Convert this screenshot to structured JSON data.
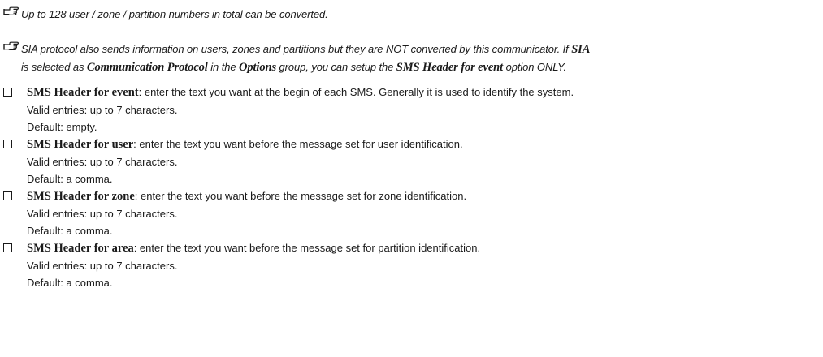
{
  "notes": [
    {
      "parts": [
        {
          "text": "Up to 128 user / zone / partition numbers in total can be converted.",
          "em": false
        }
      ]
    },
    {
      "line1": [
        {
          "text": "SIA protocol also sends information on users, zones and partitions but they are NOT converted by this communicator. If ",
          "em": false
        },
        {
          "text": "SIA",
          "em": true
        }
      ],
      "line2": [
        {
          "text": "is selected as ",
          "em": false
        },
        {
          "text": "Communication Protocol",
          "em": true
        },
        {
          "text": " in the ",
          "em": false
        },
        {
          "text": "Options",
          "em": true
        },
        {
          "text": " group, you can setup the ",
          "em": false
        },
        {
          "text": "SMS Header for event",
          "em": true
        },
        {
          "text": " option ONLY.",
          "em": false
        }
      ]
    }
  ],
  "items": [
    {
      "title": "SMS Header for event",
      "description": ": enter the text you want at the begin of each SMS. Generally it is used to identify the system.",
      "valid": "Valid entries: up to 7 characters.",
      "default": "Default: empty."
    },
    {
      "title": "SMS Header for user",
      "description": ": enter the text you want before the message set for user identification.",
      "valid": "Valid entries: up to 7 characters.",
      "default": "Default: a comma."
    },
    {
      "title": "SMS Header for zone",
      "description": ": enter the text you want before the message set for zone identification.",
      "valid": "Valid entries: up to 7 characters.",
      "default": "Default: a comma."
    },
    {
      "title": "SMS Header for area",
      "description": ": enter the text you want before the message set for partition identification.",
      "valid": "Valid entries: up to 7 characters.",
      "default": "Default: a comma."
    }
  ]
}
